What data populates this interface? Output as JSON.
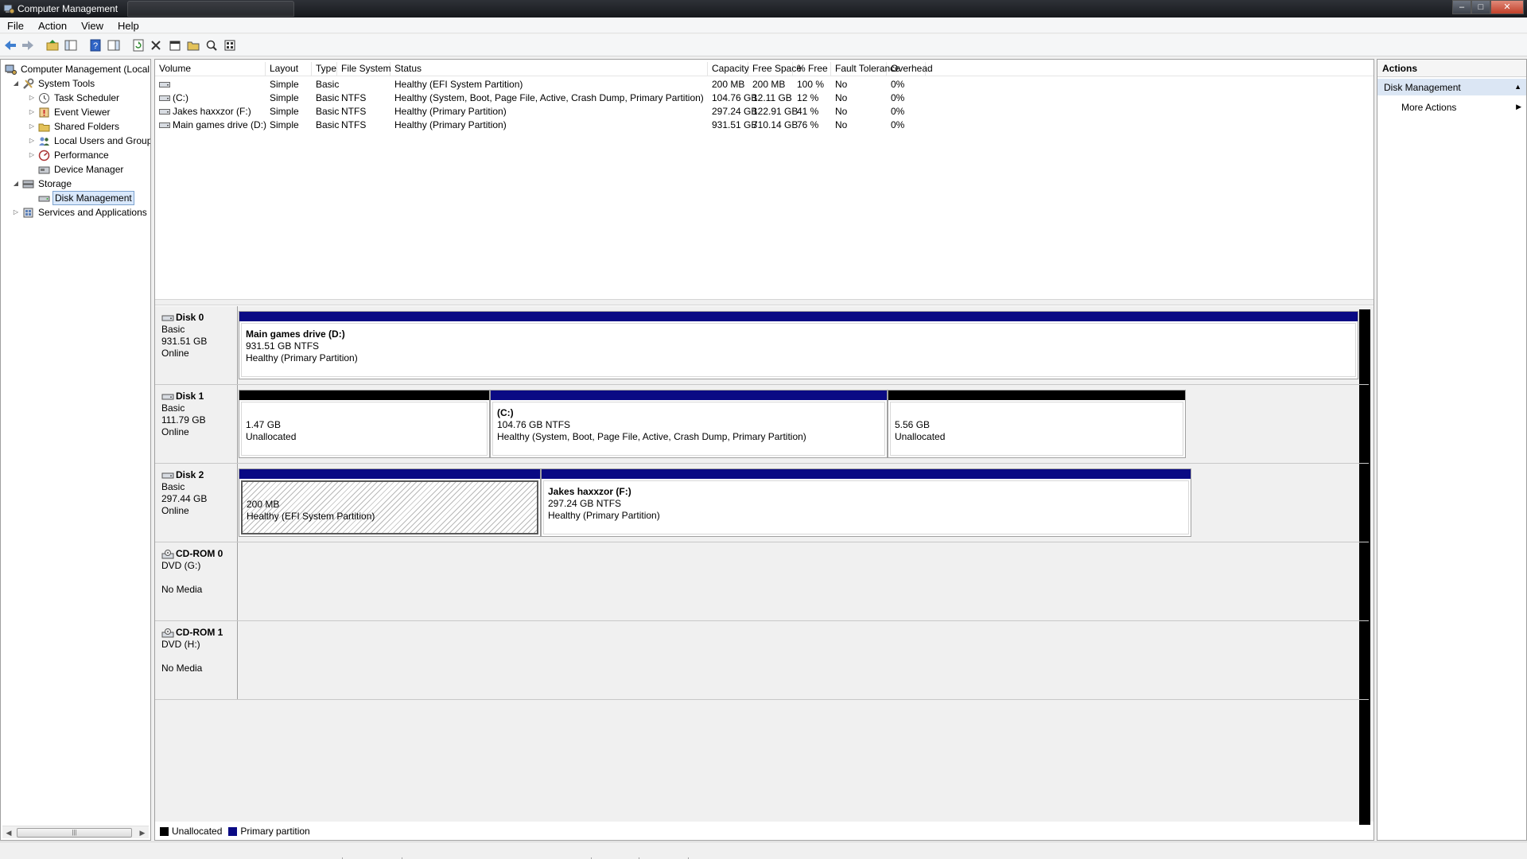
{
  "window": {
    "title": "Computer Management"
  },
  "menu": [
    "File",
    "Action",
    "View",
    "Help"
  ],
  "tree": {
    "root": "Computer Management (Local",
    "items": [
      {
        "label": "System Tools",
        "level": 1,
        "expander": "open",
        "icon": "tools-icon"
      },
      {
        "label": "Task Scheduler",
        "level": 2,
        "expander": "closed",
        "icon": "clock-icon"
      },
      {
        "label": "Event Viewer",
        "level": 2,
        "expander": "closed",
        "icon": "event-viewer-icon"
      },
      {
        "label": "Shared Folders",
        "level": 2,
        "expander": "closed",
        "icon": "folder-icon"
      },
      {
        "label": "Local Users and Groups",
        "level": 2,
        "expander": "closed",
        "icon": "users-icon"
      },
      {
        "label": "Performance",
        "level": 2,
        "expander": "closed",
        "icon": "performance-icon"
      },
      {
        "label": "Device Manager",
        "level": 2,
        "expander": "none",
        "icon": "device-manager-icon"
      },
      {
        "label": "Storage",
        "level": 1,
        "expander": "open",
        "icon": "storage-icon"
      },
      {
        "label": "Disk Management",
        "level": 2,
        "expander": "none",
        "icon": "disk-icon",
        "selected": true
      },
      {
        "label": "Services and Applications",
        "level": 1,
        "expander": "closed",
        "icon": "services-icon"
      }
    ]
  },
  "volumes": {
    "columns": [
      "Volume",
      "Layout",
      "Type",
      "File System",
      "Status",
      "Capacity",
      "Free Space",
      "% Free",
      "Fault Tolerance",
      "Overhead"
    ],
    "rows": [
      [
        "",
        "Simple",
        "Basic",
        "",
        "Healthy (EFI System Partition)",
        "200 MB",
        "200 MB",
        "100 %",
        "No",
        "0%"
      ],
      [
        "(C:)",
        "Simple",
        "Basic",
        "NTFS",
        "Healthy (System, Boot, Page File, Active, Crash Dump, Primary Partition)",
        "104.76 GB",
        "12.11 GB",
        "12 %",
        "No",
        "0%"
      ],
      [
        "Jakes haxxzor (F:)",
        "Simple",
        "Basic",
        "NTFS",
        "Healthy (Primary Partition)",
        "297.24 GB",
        "122.91 GB",
        "41 %",
        "No",
        "0%"
      ],
      [
        "Main games drive (D:)",
        "Simple",
        "Basic",
        "NTFS",
        "Healthy (Primary Partition)",
        "931.51 GB",
        "710.14 GB",
        "76 %",
        "No",
        "0%"
      ]
    ]
  },
  "disks": [
    {
      "name": "Disk 0",
      "type": "Basic",
      "size": "931.51 GB",
      "state": "Online",
      "partitions": [
        {
          "name": "Main games drive  (D:)",
          "size": "931.51 GB NTFS",
          "status": "Healthy (Primary Partition)",
          "kind": "primary"
        }
      ]
    },
    {
      "name": "Disk 1",
      "type": "Basic",
      "size": "111.79 GB",
      "state": "Online",
      "partitions": [
        {
          "name": "",
          "size": "1.47 GB",
          "status": "Unallocated",
          "kind": "unallocated"
        },
        {
          "name": "(C:)",
          "size": "104.76 GB NTFS",
          "status": "Healthy (System, Boot, Page File, Active, Crash Dump, Primary Partition)",
          "kind": "primary"
        },
        {
          "name": "",
          "size": "5.56 GB",
          "status": "Unallocated",
          "kind": "unallocated"
        }
      ]
    },
    {
      "name": "Disk 2",
      "type": "Basic",
      "size": "297.44 GB",
      "state": "Online",
      "partitions": [
        {
          "name": "",
          "size": "200 MB",
          "status": "Healthy (EFI System Partition)",
          "kind": "efi"
        },
        {
          "name": "Jakes haxxzor  (F:)",
          "size": "297.24 GB NTFS",
          "status": "Healthy (Primary Partition)",
          "kind": "primary"
        }
      ]
    },
    {
      "name": "CD-ROM 0",
      "type": "DVD (G:)",
      "state": "No Media",
      "partitions": []
    },
    {
      "name": "CD-ROM 1",
      "type": "DVD (H:)",
      "state": "No Media",
      "partitions": []
    }
  ],
  "legend": [
    {
      "label": "Unallocated",
      "color": "#000000"
    },
    {
      "label": "Primary partition",
      "color": "#0a0a84"
    }
  ],
  "actions": {
    "header": "Actions",
    "section": "Disk Management",
    "items": [
      "More Actions"
    ]
  },
  "colors": {
    "primary": "#0a0a84",
    "unallocated": "#000000",
    "selection": "#d9e8fb"
  }
}
